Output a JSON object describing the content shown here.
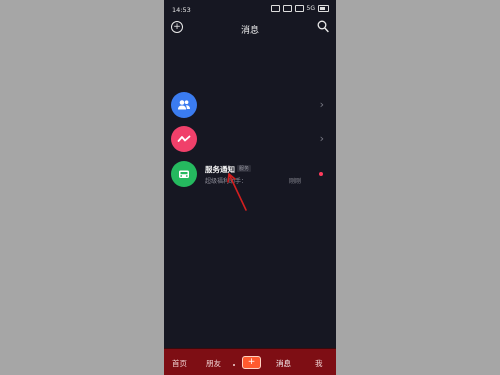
{
  "status_bar": {
    "time": "14:53",
    "signal_text": "5G"
  },
  "header": {
    "title": "消息",
    "left_icon": "add-circle-icon",
    "right_icon": "search-icon"
  },
  "messages": {
    "items": [
      {
        "icon": "people-icon",
        "color": "#3b7cf0",
        "title": "",
        "subtitle": "",
        "time": "",
        "has_chevron": true
      },
      {
        "icon": "wave-icon",
        "color": "#f0406a",
        "title": "",
        "subtitle": "",
        "time": "",
        "has_chevron": true
      },
      {
        "icon": "car-icon",
        "color": "#25b95f",
        "title": "服务通知",
        "tag": "服务",
        "subtitle": "超级福利助手：",
        "time": "刚刚",
        "unread": true
      }
    ]
  },
  "bottom_nav": {
    "items": [
      {
        "label": "首页"
      },
      {
        "label": "朋友"
      },
      {
        "label": "+"
      },
      {
        "label": "消息",
        "active": true
      },
      {
        "label": "我"
      }
    ]
  },
  "colors": {
    "background": "#161722",
    "nav_background": "#7e0e14",
    "accent": "#ff5a2f",
    "annotation": "#d21f1f"
  }
}
